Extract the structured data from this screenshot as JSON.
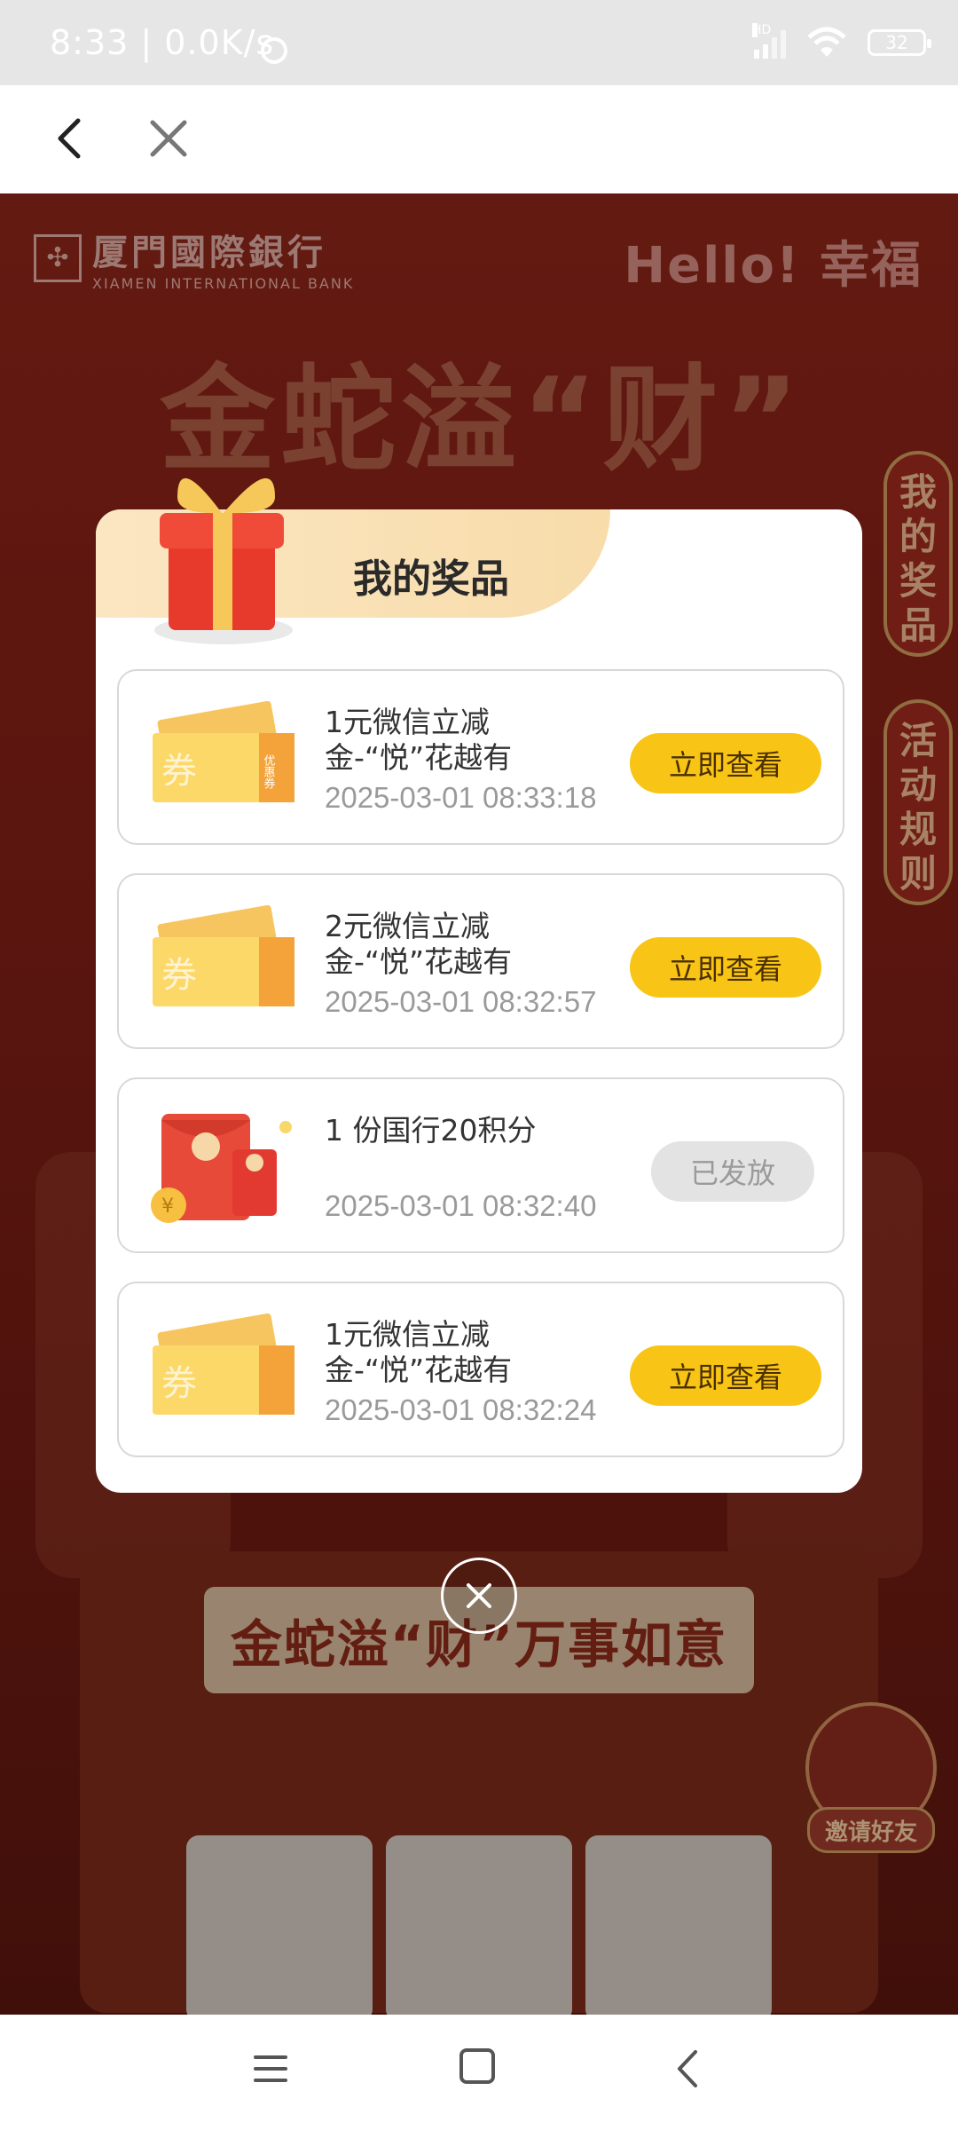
{
  "status_bar": {
    "time": "8:33 | 0.0K/s",
    "battery": "32",
    "network_tag": "HD"
  },
  "background": {
    "bank_name": "厦門國際銀行",
    "bank_name_en": "XIAMEN INTERNATIONAL BANK",
    "brand_slogan": "Hello! 幸福",
    "banner_title": "金蛇溢“财”",
    "side_tabs": [
      {
        "label": "我的奖品"
      },
      {
        "label": "活动规则"
      }
    ],
    "slot_title": "金蛇溢“财”万事如意",
    "invite_label": "邀请好友"
  },
  "modal": {
    "title": "我的奖品",
    "prizes": [
      {
        "name": "1元微信立减金-“悦”花越有",
        "date": "2025-03-01 08:33:18",
        "action": "立即查看",
        "type": "coupon"
      },
      {
        "name": "2元微信立减金-“悦”花越有",
        "date": "2025-03-01 08:32:57",
        "action": "立即查看",
        "type": "coupon"
      },
      {
        "name": "1 份国行20积分",
        "date": "2025-03-01 08:32:40",
        "action": "已发放",
        "type": "points"
      },
      {
        "name": "1元微信立减金-“悦”花越有",
        "date": "2025-03-01 08:32:24",
        "action": "立即查看",
        "type": "coupon"
      }
    ],
    "coupon_stamp": "券",
    "coupon_side": "优惠券"
  },
  "colors": {
    "accent_button": "#f8c415",
    "disabled_button": "#e3e3e3",
    "header_gradient": "#fbe6c2"
  }
}
